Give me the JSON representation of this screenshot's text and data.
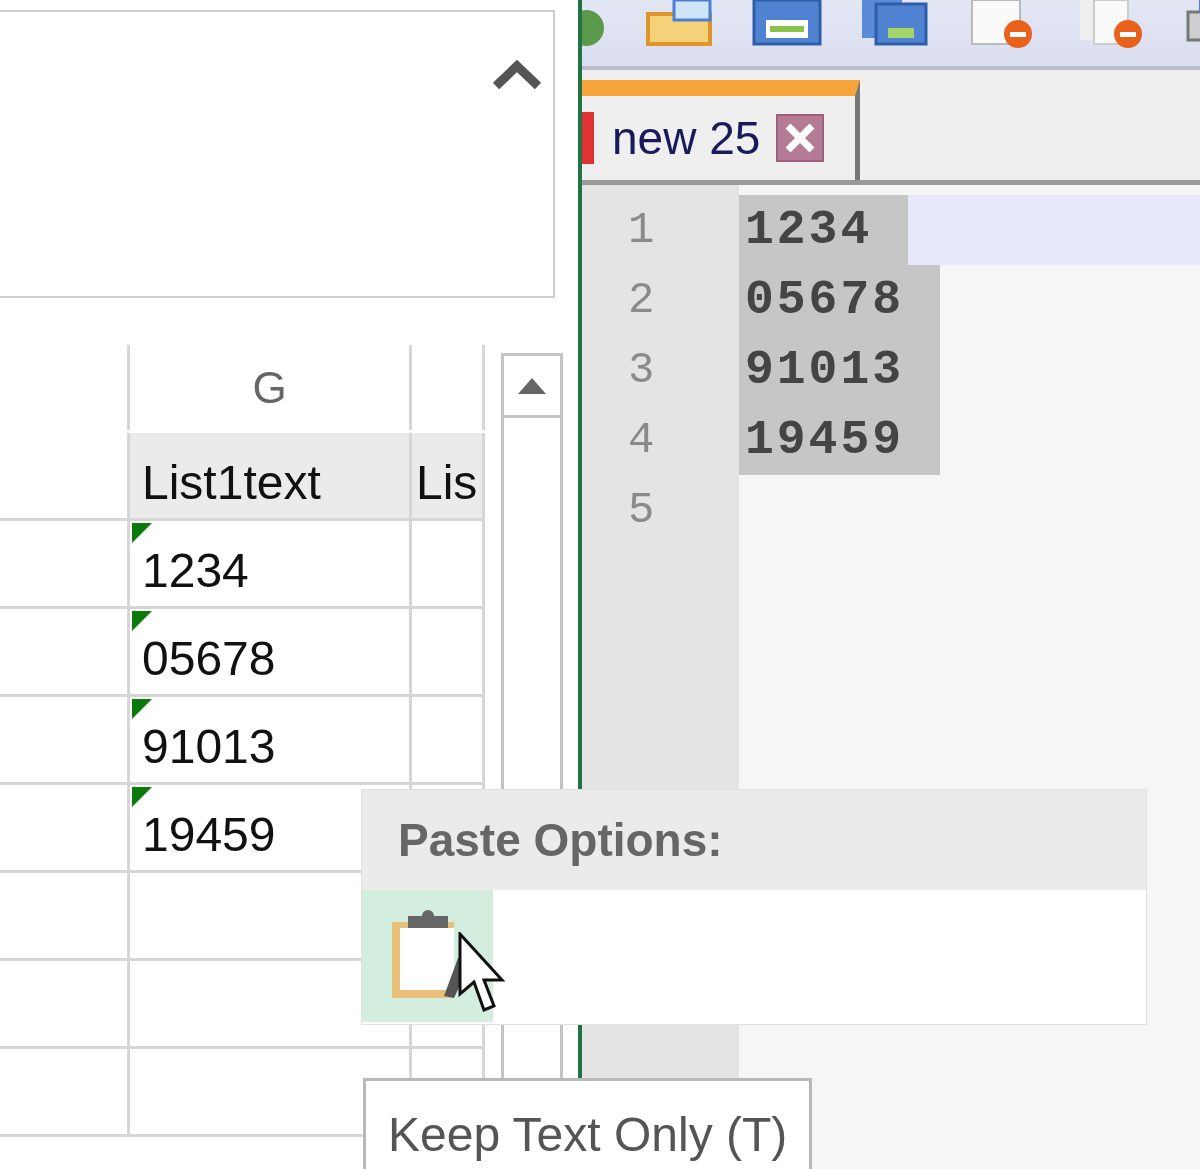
{
  "excel": {
    "column_headers": [
      "G"
    ],
    "table": {
      "columns": [
        "List1text",
        "Lis"
      ],
      "rows": [
        {
          "value": "1234",
          "flagged": true
        },
        {
          "value": "05678",
          "flagged": true
        },
        {
          "value": "91013",
          "flagged": true
        },
        {
          "value": "19459",
          "flagged": true
        }
      ]
    }
  },
  "notepad": {
    "tabs": [
      {
        "label": "new 25",
        "selected": true
      }
    ],
    "lines": [
      {
        "number": "1",
        "text": "1234",
        "current": true,
        "selected": true
      },
      {
        "number": "2",
        "text": "05678",
        "current": false,
        "selected": true
      },
      {
        "number": "3",
        "text": "91013",
        "current": false,
        "selected": true
      },
      {
        "number": "4",
        "text": "19459",
        "current": false,
        "selected": true
      },
      {
        "number": "5"
      }
    ]
  },
  "paste_menu": {
    "title": "Paste Options:",
    "options": [
      {
        "kind": "keep-text-only",
        "selected": true
      }
    ],
    "tooltip": "Keep Text Only (T)"
  }
}
